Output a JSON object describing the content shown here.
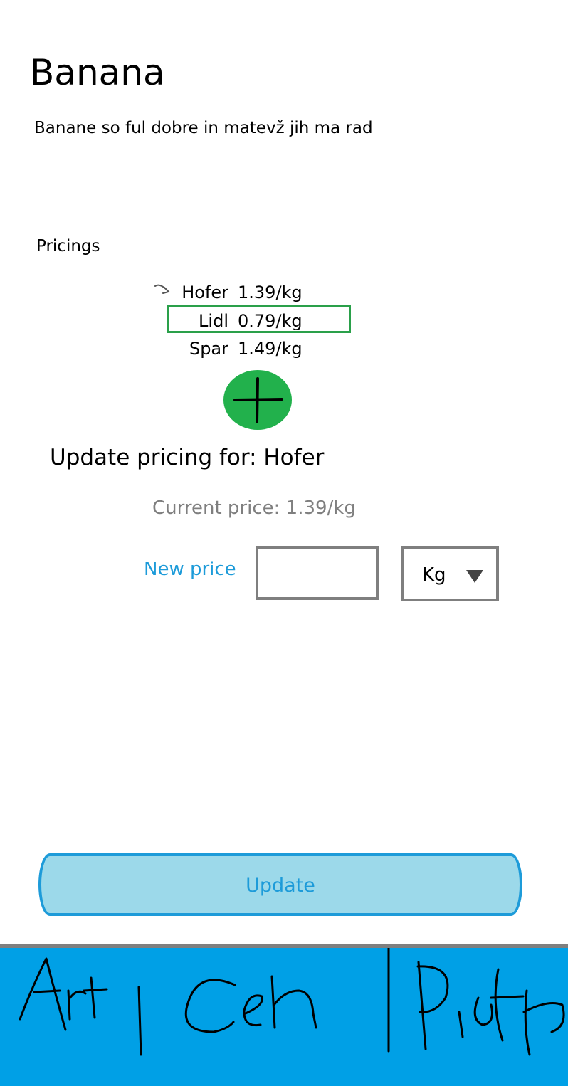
{
  "product": {
    "title": "Banana",
    "description": "Banane so ful dobre in matevž jih ma rad"
  },
  "pricings": {
    "label": "Pricings",
    "items": [
      {
        "store": "Hofer",
        "price": "1.39/kg",
        "selected": true
      },
      {
        "store": "Lidl",
        "price": "0.79/kg",
        "best": true
      },
      {
        "store": "Spar",
        "price": "1.49/kg"
      }
    ],
    "add_icon": "plus-icon",
    "highlight_color": "#2aa04a",
    "add_button_color": "#22b14c"
  },
  "update_form": {
    "heading": "Update pricing for: Hofer",
    "current_price": "Current price: 1.39/kg",
    "new_price_label": "New price",
    "new_price_value": "",
    "unit_selected": "Kg",
    "submit_label": "Update"
  },
  "bottom_nav": {
    "items": [
      {
        "label": "Art"
      },
      {
        "label": "Ceh"
      },
      {
        "label": "Profile"
      }
    ],
    "color": "#00a0e6"
  },
  "colors": {
    "accent": "#1d9bd9",
    "muted_text": "#7f7f7f",
    "button_fill": "#9cd9ea"
  }
}
